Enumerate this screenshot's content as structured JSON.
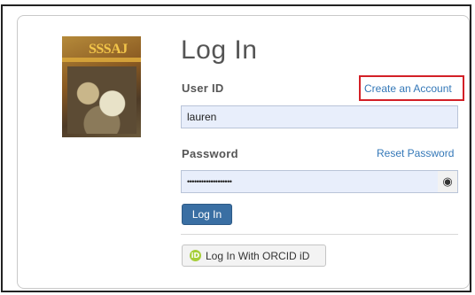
{
  "page": {
    "title": "Log In"
  },
  "journal": {
    "cover_title": "SSSAJ"
  },
  "form": {
    "user_id_label": "User ID",
    "create_account_link": "Create an Account",
    "user_id_value": "lauren",
    "password_label": "Password",
    "reset_password_link": "Reset Password",
    "password_mask": "•••••••••••••••••••",
    "show_password_icon": "eye-icon",
    "login_button": "Log In",
    "orcid_button": "Log In With ORCID iD",
    "orcid_icon": "orcid-icon"
  },
  "colors": {
    "link": "#3478b8",
    "primary_button": "#3a6fa3",
    "input_background": "#e8eefb",
    "highlight_box": "#d32027",
    "orcid_green": "#a6ce39"
  }
}
